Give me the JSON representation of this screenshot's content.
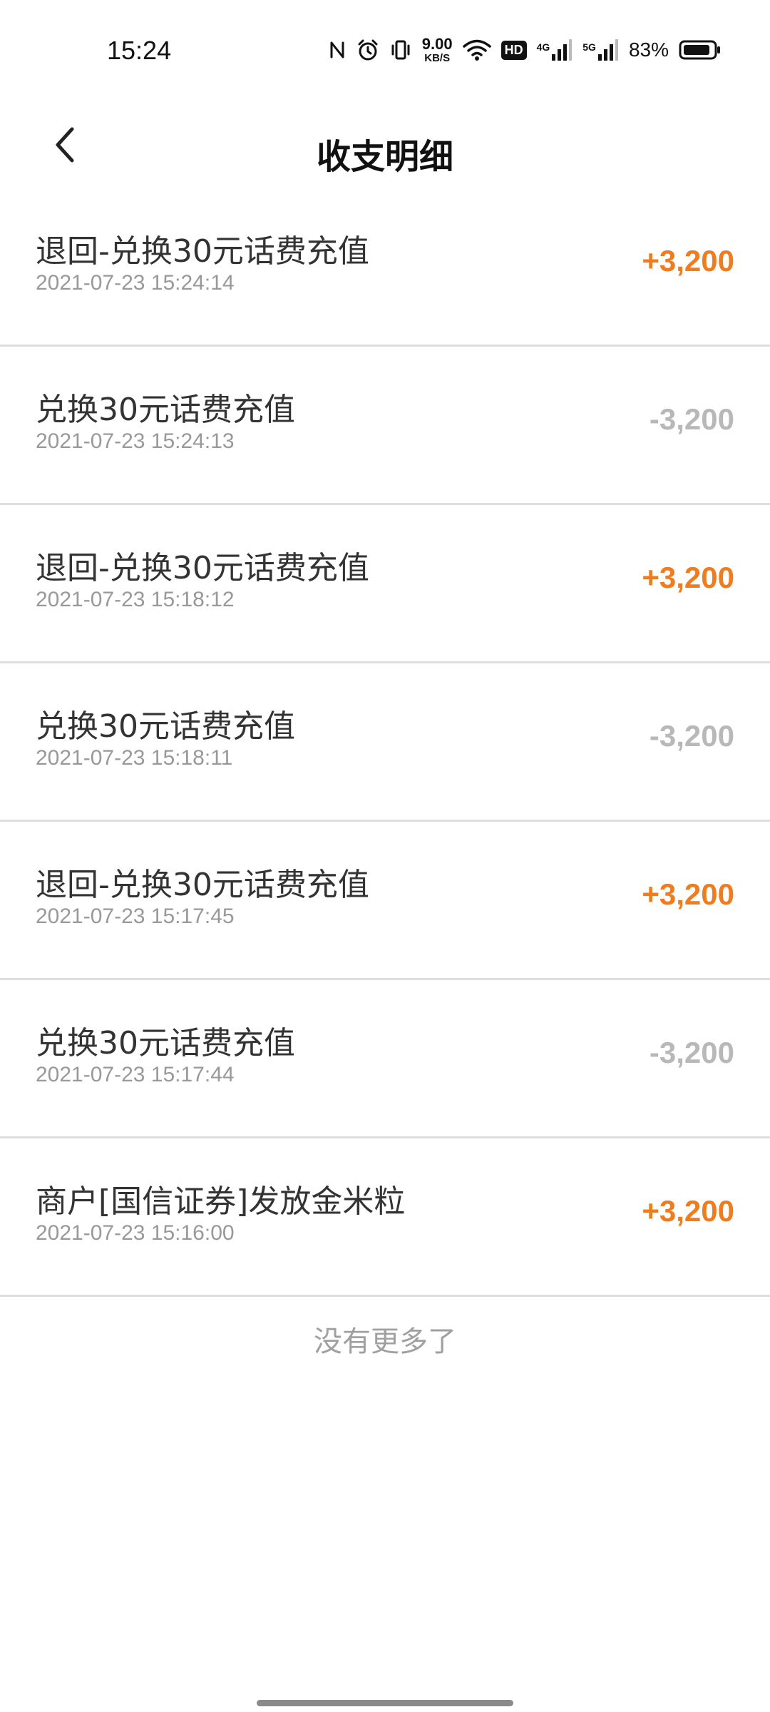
{
  "status_bar": {
    "time": "15:24",
    "net_speed_value": "9.00",
    "net_speed_unit": "KB/S",
    "hd_label": "HD",
    "sim1_label": "4G",
    "sim2_label": "5G",
    "battery_percent": "83%",
    "icons": [
      "nfc-icon",
      "alarm-icon",
      "vibrate-icon",
      "wifi-icon",
      "signal-icon",
      "battery-icon"
    ]
  },
  "header": {
    "title": "收支明细",
    "back_icon": "chevron-left-icon"
  },
  "transactions": [
    {
      "title": "退回-兑换30元话费充值",
      "time": "2021-07-23 15:24:14",
      "amount": "+3,200",
      "type": "positive"
    },
    {
      "title": "兑换30元话费充值",
      "time": "2021-07-23 15:24:13",
      "amount": "-3,200",
      "type": "negative"
    },
    {
      "title": "退回-兑换30元话费充值",
      "time": "2021-07-23 15:18:12",
      "amount": "+3,200",
      "type": "positive"
    },
    {
      "title": "兑换30元话费充值",
      "time": "2021-07-23 15:18:11",
      "amount": "-3,200",
      "type": "negative"
    },
    {
      "title": "退回-兑换30元话费充值",
      "time": "2021-07-23 15:17:45",
      "amount": "+3,200",
      "type": "positive"
    },
    {
      "title": "兑换30元话费充值",
      "time": "2021-07-23 15:17:44",
      "amount": "-3,200",
      "type": "negative"
    },
    {
      "title": "商户[国信证券]发放金米粒",
      "time": "2021-07-23 15:16:00",
      "amount": "+3,200",
      "type": "positive"
    }
  ],
  "footer": {
    "end_note": "没有更多了"
  },
  "colors": {
    "positive_amount": "#f07c1e",
    "negative_amount": "#b8b8b8",
    "divider": "#dedede"
  }
}
